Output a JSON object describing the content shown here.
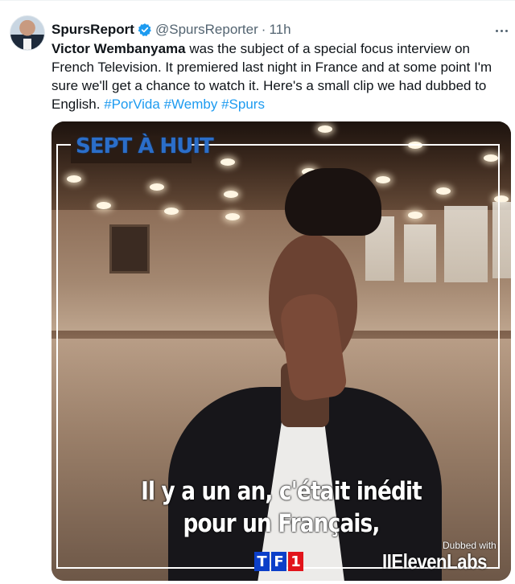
{
  "tweet": {
    "display_name": "SpursReport",
    "handle": "@SpursReporter",
    "separator": "·",
    "time": "11h",
    "text_highlight": "Victor Wembanyama",
    "text_body": " was the subject of a special focus interview on French Television. It premiered last night in France and at some point I'm sure we'll get a chance to watch it. Here's a small clip we had dubbed to English. ",
    "hashtags": [
      "#PorVida",
      "#Wemby",
      "#Spurs"
    ]
  },
  "media": {
    "channel_logo": "SEPT À HUIT",
    "subtitle_line1": "Il y a un an, c'était inédit",
    "subtitle_line2": "pour un Français,",
    "dubbed_label": "Dubbed with",
    "dubbed_brand": "IIElevenLabs",
    "tv_logo": [
      "T",
      "F",
      "1"
    ]
  },
  "icons": {
    "verified": "verified-badge-icon",
    "more": "more-options-icon"
  },
  "colors": {
    "accent": "#1d9bf0",
    "text": "#0f1419",
    "muted": "#536471"
  }
}
